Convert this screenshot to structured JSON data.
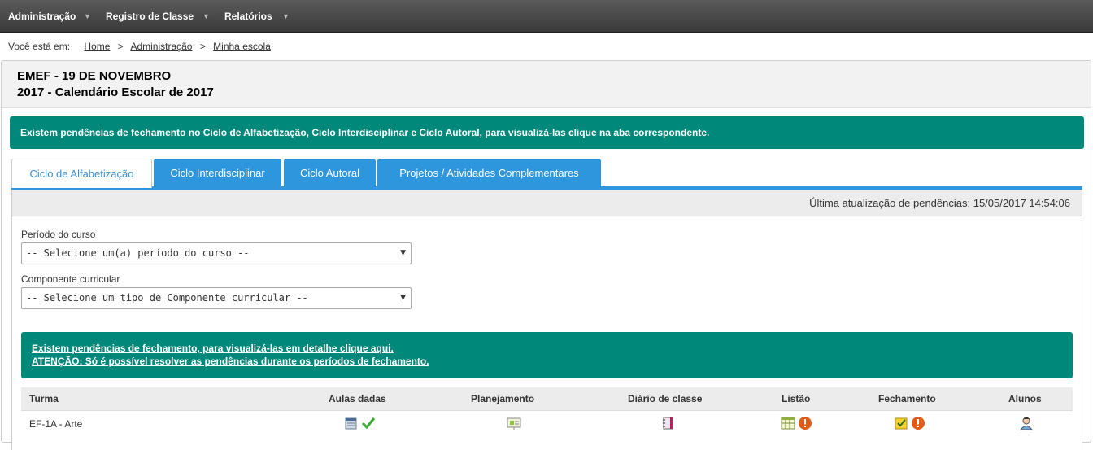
{
  "menu": {
    "items": [
      {
        "label": "Administração"
      },
      {
        "label": "Registro de Classe"
      },
      {
        "label": "Relatórios"
      }
    ],
    "caret": "▼"
  },
  "breadcrumb": {
    "label": "Você está em:",
    "items": [
      "Home",
      "Administração",
      "Minha escola"
    ],
    "separator": ">"
  },
  "header": {
    "school": "EMEF - 19 DE NOVEMBRO",
    "calendar": "2017 - Calendário Escolar de 2017"
  },
  "alert_top": "Existem pendências de fechamento no Ciclo de Alfabetização, Ciclo Interdisciplinar e Ciclo Autoral, para visualizá-las clique na aba correspondente.",
  "tabs": [
    {
      "label": "Ciclo de Alfabetização",
      "active": true
    },
    {
      "label": "Ciclo Interdisciplinar",
      "active": false
    },
    {
      "label": "Ciclo Autoral",
      "active": false
    },
    {
      "label": "Projetos / Atividades Complementares",
      "active": false
    }
  ],
  "last_update": "Última atualização de pendências: 15/05/2017 14:54:06",
  "filters": {
    "periodo": {
      "label": "Período do curso",
      "value": "-- Selecione um(a) período do curso --"
    },
    "componente": {
      "label": "Componente curricular",
      "value": "-- Selecione um tipo de Componente curricular --"
    }
  },
  "alert_inner": {
    "line1": "Existem pendências de fechamento, para visualizá-las em detalhe clique aqui.",
    "line2": "ATENÇÃO: Só é possível resolver as pendências durante os períodos de fechamento."
  },
  "table": {
    "columns": [
      "Turma",
      "Aulas dadas",
      "Planejamento",
      "Diário de classe",
      "Listão",
      "Fechamento",
      "Alunos"
    ],
    "rows": [
      {
        "turma": "EF-1A - Arte",
        "aulas_status": "ok",
        "listao_status": "pending",
        "fechamento_status": "pending"
      }
    ]
  },
  "colors": {
    "menu_bg": "#444444",
    "alert_bg": "#00897b",
    "tab_blue": "#2e96dc",
    "warning": "#e05a1a",
    "check": "#3aaa35"
  }
}
